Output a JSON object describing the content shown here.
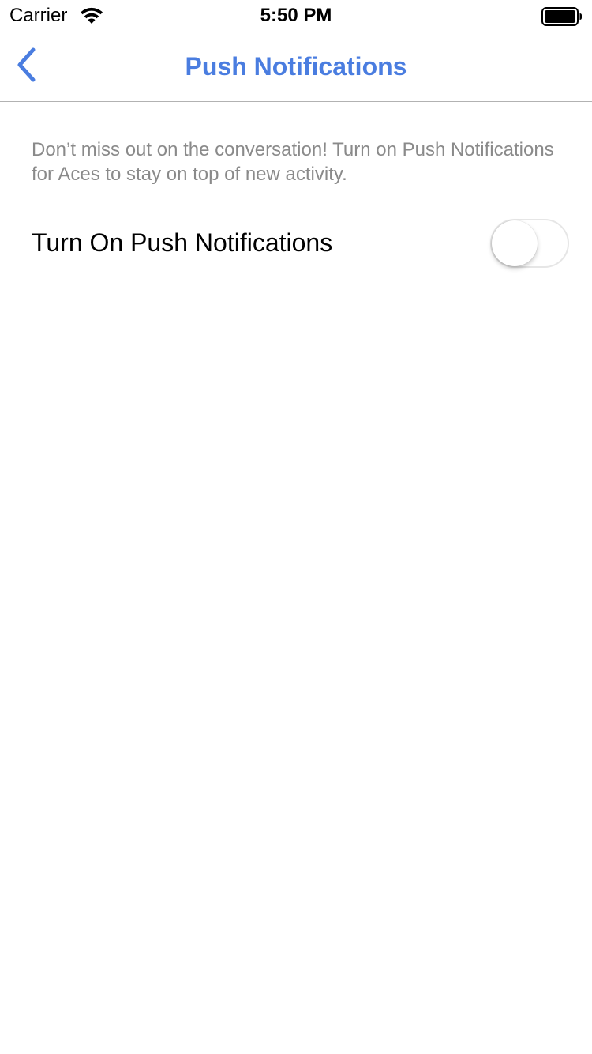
{
  "status_bar": {
    "carrier": "Carrier",
    "time": "5:50 PM",
    "wifi_icon": "wifi-icon",
    "battery_icon": "battery-full-icon"
  },
  "nav": {
    "title": "Push Notifications",
    "back_icon": "chevron-left-icon",
    "accent_color": "#4a7de0"
  },
  "content": {
    "description": "Don’t miss out on the conversation! Turn on Push Notifications for Aces to stay on top of new activity.",
    "toggle": {
      "label": "Turn On Push Notifications",
      "on": false
    }
  }
}
